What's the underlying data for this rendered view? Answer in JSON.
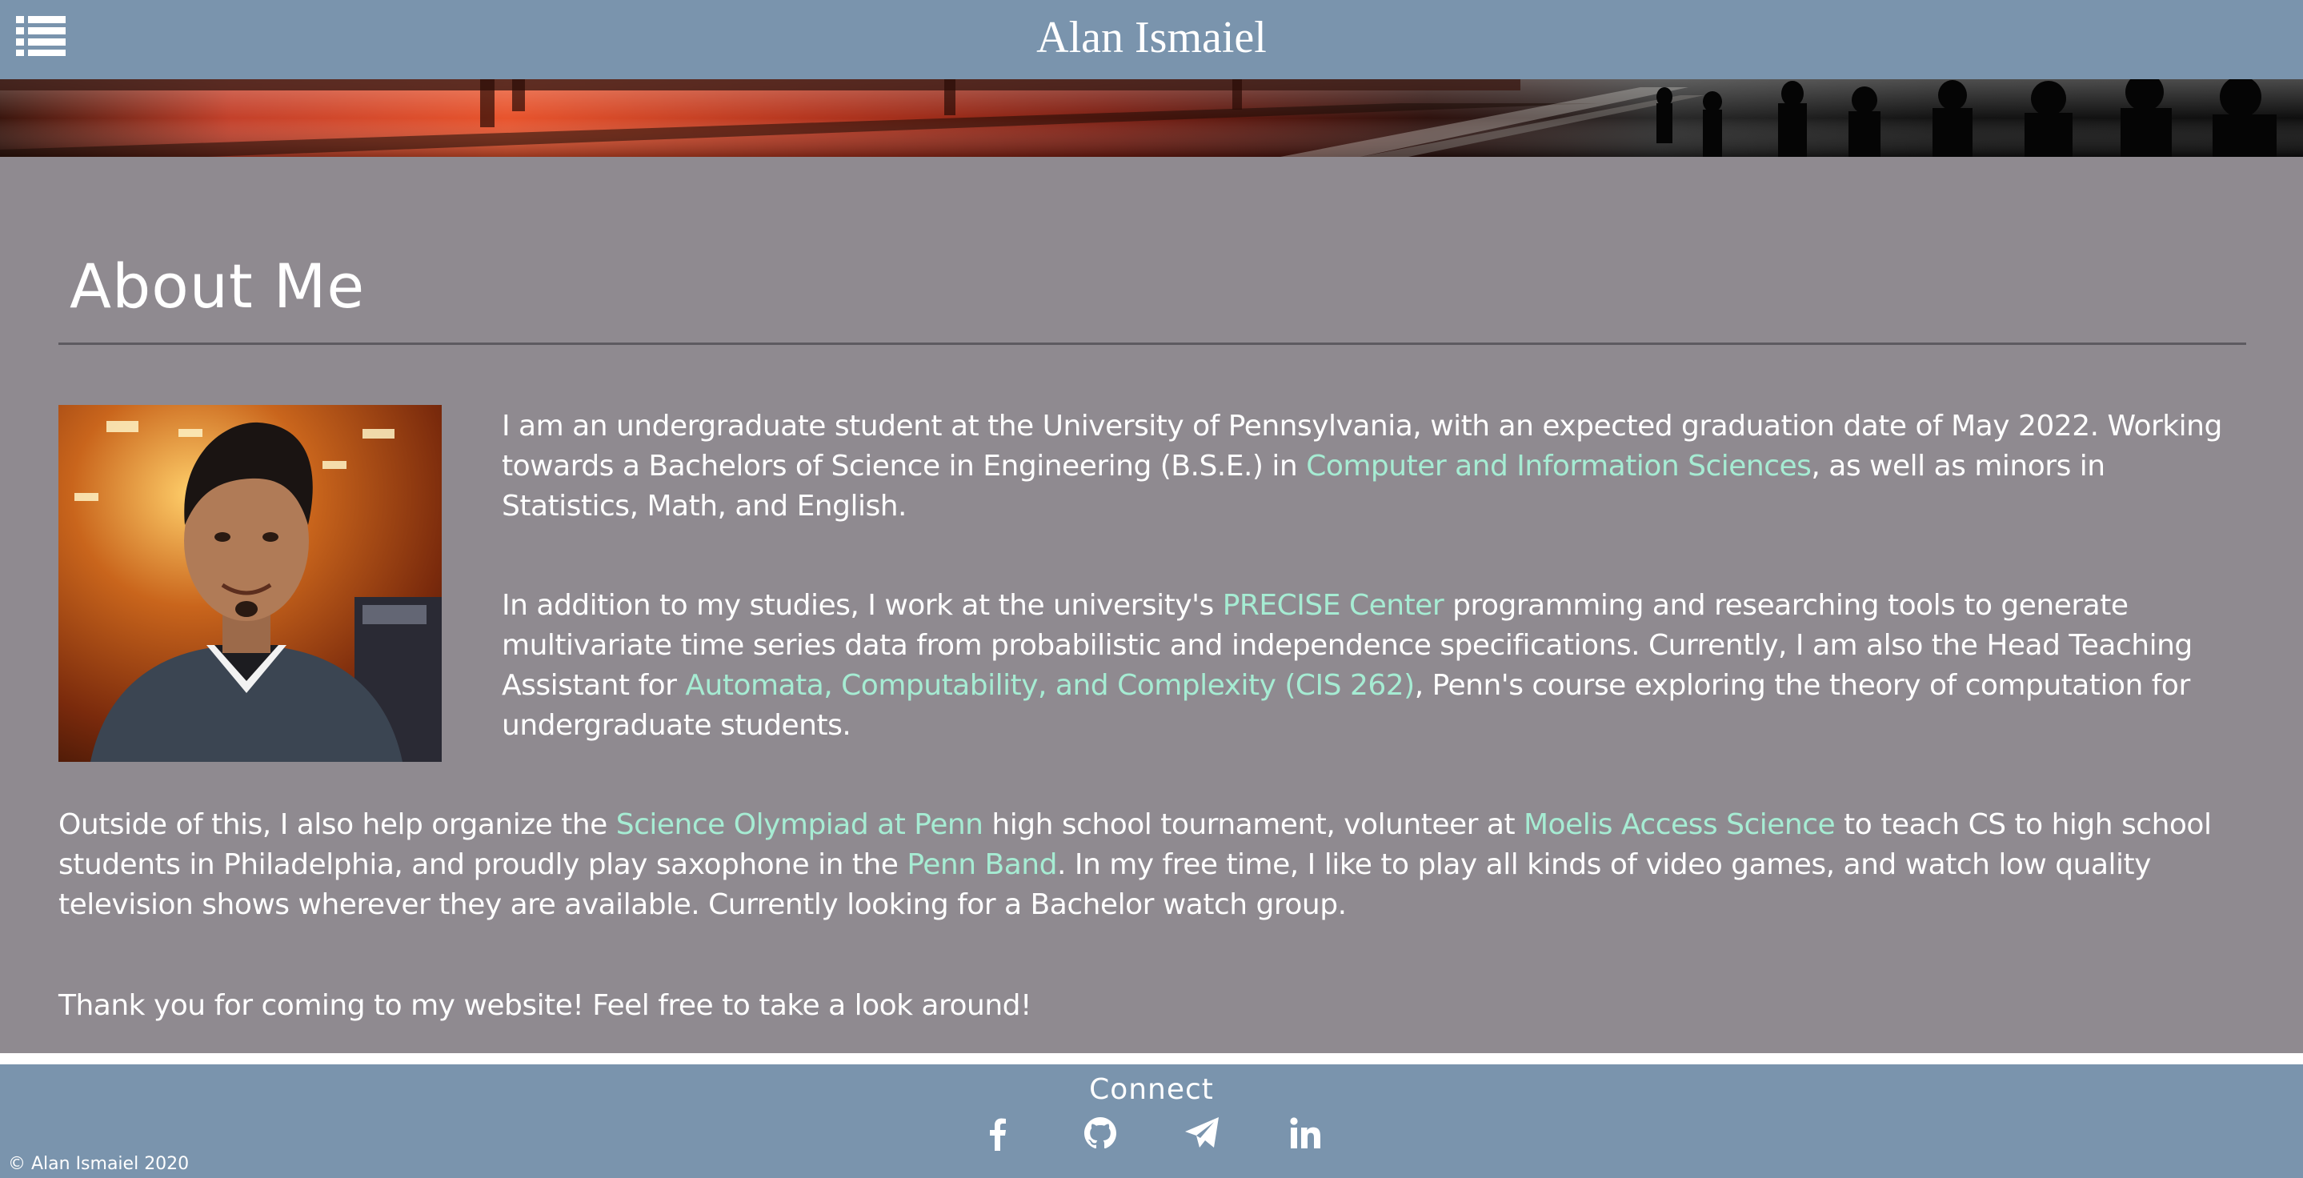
{
  "header": {
    "title": "Alan Ismaiel",
    "menu_icon": "list-menu-icon"
  },
  "banner": {
    "description_icon": "subway-banner-image"
  },
  "about": {
    "heading": "About Me",
    "p1": {
      "t1": "I am an undergraduate student at the University of Pennsylvania, with an expected graduation date of May 2022. Working towards a Bachelors of Science in Engineering (B.S.E.) in ",
      "link1": "Computer and Information Sciences",
      "t2": ", as well as minors in Statistics, Math, and English."
    },
    "p2": {
      "t1": "In addition to my studies, I work at the university's ",
      "link1": "PRECISE Center",
      "t2": " programming and researching tools to generate multivariate time series data from probabilistic and independence specifications. Currently, I am also the Head Teaching Assistant for ",
      "link2": "Automata, Computability, and Complexity (CIS 262)",
      "t3": ", Penn's course exploring the theory of computation for undergraduate students."
    },
    "p3": {
      "t1": "Outside of this, I also help organize the ",
      "link1": "Science Olympiad at Penn",
      "t2": " high school tournament, volunteer at ",
      "link2": "Moelis Access Science",
      "t3": " to teach CS to high school students in Philadelphia, and proudly play saxophone in the ",
      "link3": "Penn Band",
      "t4": ". In my free time, I like to play all kinds of video games, and watch low quality television shows wherever they are available. Currently looking for a Bachelor watch group."
    },
    "p4": "Thank you for coming to my website! Feel free to take a look around!"
  },
  "colors": {
    "header_bg": "#7a94ad",
    "main_bg": "#8f8a90",
    "link": "#a6ecd3",
    "text": "#ffffff"
  },
  "footer": {
    "connect_label": "Connect",
    "social_icons": [
      "facebook-icon",
      "github-icon",
      "telegram-icon",
      "linkedin-icon"
    ],
    "copyright": "© Alan Ismaiel 2020"
  }
}
